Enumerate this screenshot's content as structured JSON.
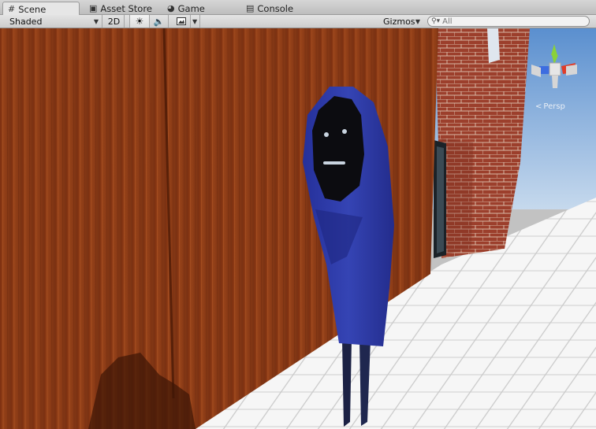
{
  "tabs": [
    {
      "label": "Scene",
      "icon": "grid-icon",
      "active": true
    },
    {
      "label": "Asset Store",
      "icon": "bag-icon",
      "active": false
    },
    {
      "label": "Game",
      "icon": "pacman-icon",
      "active": false
    },
    {
      "label": "Console",
      "icon": "document-icon",
      "active": false
    }
  ],
  "toolbar": {
    "shading_mode": "Shaded",
    "mode_2d": "2D",
    "lighting_icon": "sun-icon",
    "audio_icon": "speaker-icon",
    "effects_icon": "image-icon",
    "gizmos_label": "Gizmos",
    "search_placeholder": "All"
  },
  "scene_gizmo": {
    "projection_label": "Persp",
    "axis_colors": {
      "x": "#e03c28",
      "y": "#8ad13a",
      "z": "#3d6de0"
    }
  },
  "colors": {
    "sky_top": "#5a8fcf",
    "sky_bottom": "#bcd3ea",
    "wood": "#8a3a16",
    "brick": "#9a3d2b",
    "hood": "#2b36a0",
    "face": "#0c0c10",
    "floor": "#f4f4f4"
  }
}
